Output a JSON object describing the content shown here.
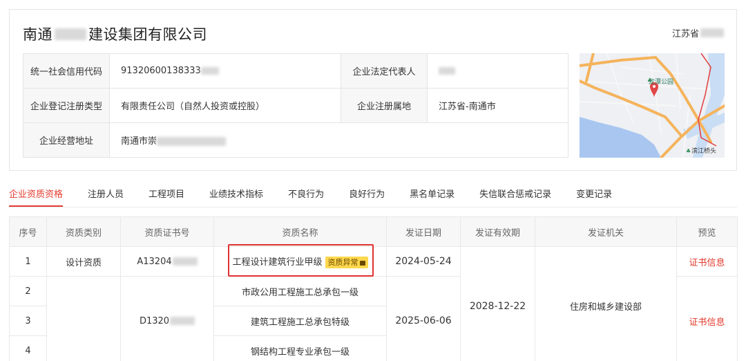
{
  "company": {
    "name_prefix": "南通",
    "name_suffix": "建设集团有限公司",
    "province_prefix": "江苏省"
  },
  "info": {
    "credit_code_label": "统一社会信用代码",
    "credit_code_value": "91320600138333",
    "legal_rep_label": "企业法定代表人",
    "reg_type_label": "企业登记注册类型",
    "reg_type_value": "有限责任公司（自然人投资或控股）",
    "reg_place_label": "企业注册属地",
    "reg_place_value": "江苏省-南通市",
    "address_label": "企业经营地址",
    "address_value": "南通市崇"
  },
  "map": {
    "poi1": "龙潭公园",
    "poi2": "滨江桥头"
  },
  "tabs": [
    "企业资质资格",
    "注册人员",
    "工程项目",
    "业绩技术指标",
    "不良行为",
    "良好行为",
    "黑名单记录",
    "失信联合惩戒记录",
    "变更记录"
  ],
  "table": {
    "headers": [
      "序号",
      "资质类别",
      "资质证书号",
      "资质名称",
      "发证日期",
      "发证有效期",
      "发证机关",
      "预览"
    ],
    "rows": [
      {
        "no": "1",
        "category": "设计资质",
        "cert_no": "A13204",
        "name": "工程设计建筑行业甲级",
        "badge": "资质异常",
        "issue_date": "2024-05-24",
        "preview": "证书信息"
      },
      {
        "no": "2",
        "name": "市政公用工程施工总承包一级"
      },
      {
        "no": "3",
        "cert_no": "D1320",
        "name": "建筑工程施工总承包特级",
        "issue_date": "2025-06-06",
        "preview": "证书信息"
      },
      {
        "no": "4",
        "name": "钢结构工程专业承包一级"
      }
    ],
    "valid_until": "2028-12-22",
    "authority": "住房和城乡建设部"
  },
  "colors": {
    "accent": "#e23b2e",
    "badge_bg": "#ffd84d",
    "highlight": "#e03131"
  }
}
